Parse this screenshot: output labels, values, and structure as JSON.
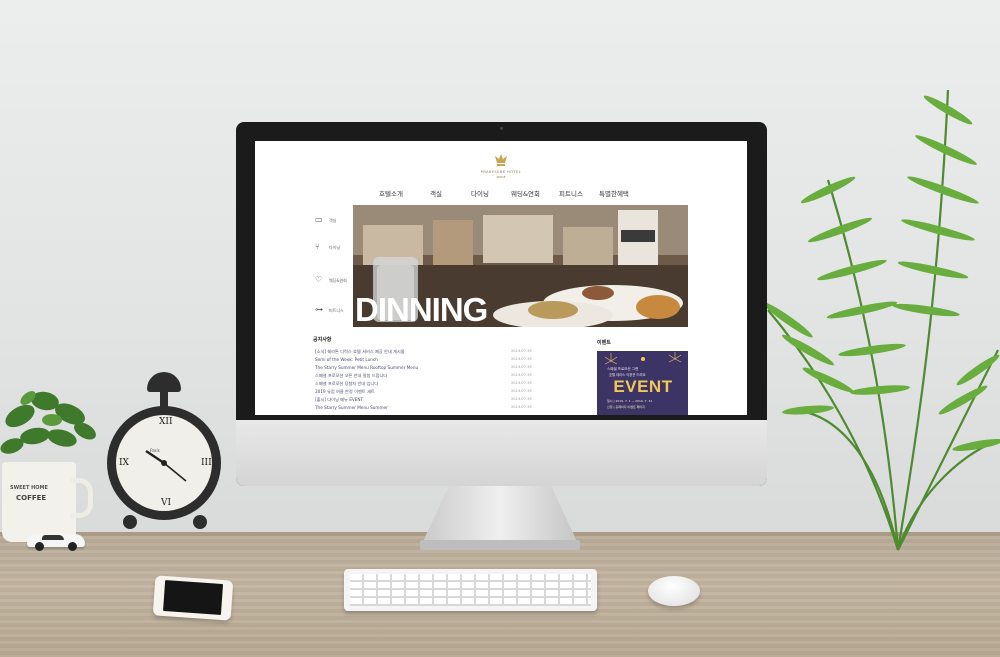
{
  "site": {
    "logo_name": "PRAKYSEBE HOTEL",
    "logo_sub": "SINCE",
    "nav": [
      "호텔소개",
      "객실",
      "다이닝",
      "웨딩&연회",
      "피트니스",
      "특별한혜택"
    ],
    "side_menu": [
      {
        "icon": "bed-icon",
        "label": "객실"
      },
      {
        "icon": "dining-icon",
        "label": "다이닝"
      },
      {
        "icon": "wedding-icon",
        "label": "웨딩&연회"
      },
      {
        "icon": "dumbbell-icon",
        "label": "피트니스"
      }
    ],
    "hero_title": "DINNING",
    "notice": {
      "title": "공지사항",
      "items": [
        {
          "text": "[소식] 쉐라톤 디럭스 호텔 서비스 제공 안내 게시물",
          "date": "2019.07.19"
        },
        {
          "text": "Semi of the Week: Petit Lunch",
          "date": "2019.07.19"
        },
        {
          "text": "The Starry Summer Menu Rooftop Summer Menu",
          "date": "2019.07.19"
        },
        {
          "text": "스페셜 프로모션 오픈 안내 말씀 드립니다",
          "date": "2019.07.19"
        },
        {
          "text": "스페셜 프로모션 당첨자 안내 입니다",
          "date": "2019.07.19"
        },
        {
          "text": "2019 유럽 여름 한정 이벤트 세트",
          "date": "2019.07.19"
        },
        {
          "text": "[출시] 다이닝 메뉴 EVENT",
          "date": "2019.07.19"
        },
        {
          "text": "The Starry Summer Menu Summer",
          "date": "2019.07.19"
        }
      ]
    },
    "event": {
      "title": "이벤트",
      "line1": "스페셜 프로모션 그랜",
      "line2": "호텔 테라스 이용권 드려요",
      "word": "EVENT",
      "small1": "일시 | 2019. 7. 1 ~ 2019. 7. 31",
      "small2": "신청 | 홈페이지 이벤트 페이지"
    }
  },
  "scene": {
    "mug_text1": "SWEET HOME",
    "mug_text2": "COFFEE",
    "clock_brand": "Paris",
    "colors": {
      "wall": "#e4e6e6",
      "desk": "#bfb19c",
      "event_bg": "#3d3466",
      "event_gold": "#f0c85a",
      "plant": "#5f9e3a"
    }
  }
}
